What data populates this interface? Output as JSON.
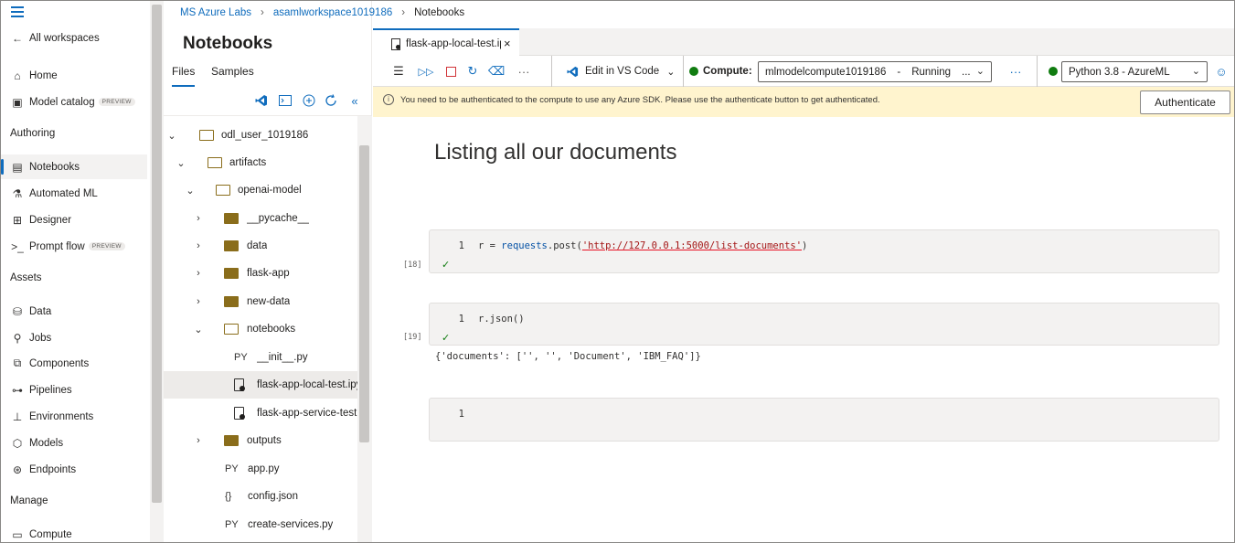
{
  "breadcrumb": {
    "items": [
      "MS Azure Labs",
      "asamlworkspace1019186",
      "Notebooks"
    ]
  },
  "leftnav": {
    "all_workspaces": "All workspaces",
    "home": "Home",
    "model_catalog": "Model catalog",
    "preview_badge": "PREVIEW",
    "section_authoring": "Authoring",
    "notebooks": "Notebooks",
    "automated_ml": "Automated ML",
    "designer": "Designer",
    "prompt_flow": "Prompt flow",
    "section_assets": "Assets",
    "data": "Data",
    "jobs": "Jobs",
    "components": "Components",
    "pipelines": "Pipelines",
    "environments": "Environments",
    "models": "Models",
    "endpoints": "Endpoints",
    "section_manage": "Manage",
    "compute": "Compute"
  },
  "filepanel": {
    "title": "Notebooks",
    "tab_files": "Files",
    "tab_samples": "Samples",
    "tree": [
      {
        "label": "odl_user_1019186",
        "type": "folder-open"
      },
      {
        "label": "artifacts",
        "type": "folder-open"
      },
      {
        "label": "openai-model",
        "type": "folder-open"
      },
      {
        "label": "__pycache__",
        "type": "folder"
      },
      {
        "label": "data",
        "type": "folder"
      },
      {
        "label": "flask-app",
        "type": "folder"
      },
      {
        "label": "new-data",
        "type": "folder"
      },
      {
        "label": "notebooks",
        "type": "folder-open"
      },
      {
        "label": "__init__.py",
        "type": "py",
        "tag": "PY"
      },
      {
        "label": "flask-app-local-test.ipynb",
        "type": "nb"
      },
      {
        "label": "flask-app-service-test.ipynb",
        "type": "nb"
      },
      {
        "label": "outputs",
        "type": "folder"
      },
      {
        "label": "app.py",
        "type": "py",
        "tag": "PY"
      },
      {
        "label": "config.json",
        "type": "json",
        "tag": "{}"
      },
      {
        "label": "create-services.py",
        "type": "py",
        "tag": "PY"
      }
    ]
  },
  "editor": {
    "tab_label": "flask-app-local-test.ipynb",
    "edit_vscode": "Edit in VS Code",
    "compute_label": "Compute:",
    "compute_value": "mlmodelcompute1019186",
    "compute_status": "Running",
    "compute_more": "...",
    "kernel_value": "Python 3.8 - AzureML",
    "banner_message": "You need to be authenticated to the compute to use any Azure SDK. Please use the authenticate button to get authenticated.",
    "authenticate_label": "Authenticate",
    "heading": "Listing all our documents",
    "cells": [
      {
        "exec": "[18]",
        "line": "1",
        "code_pre": "r = ",
        "code_obj": "requests",
        "code_fn": ".post(",
        "code_str": "'http://127.0.0.1:5000/list-documents'",
        "code_post": ")"
      },
      {
        "exec": "[19]",
        "line": "1",
        "code_pre": "r.json()",
        "output": "{'documents': ['', '', 'Document', 'IBM_FAQ']}"
      },
      {
        "exec": "",
        "line": "1"
      }
    ]
  },
  "colors": {
    "accent": "#0f6cbd",
    "banner": "#fff4ce",
    "running": "#107c10"
  }
}
